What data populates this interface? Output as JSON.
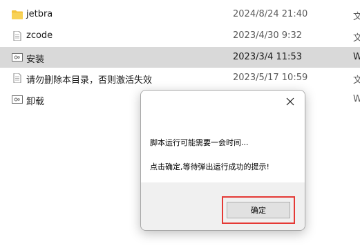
{
  "file_list": {
    "rows": [
      {
        "name": "jetbra",
        "date": "2024/8/24 21:40",
        "type": "文",
        "icon": "folder-icon",
        "selected": false
      },
      {
        "name": "zcode",
        "date": "2023/4/30 9:32",
        "type": "文",
        "icon": "text-file-icon",
        "selected": false
      },
      {
        "name": "安装",
        "date": "2023/3/4 11:53",
        "type": "W",
        "icon": "script-file-icon",
        "selected": true
      },
      {
        "name": "请勿删除本目录，否则激活失效",
        "date": "2023/5/17 10:59",
        "type": "文",
        "icon": "text-file-icon",
        "selected": false
      },
      {
        "name": "卸载",
        "date": "",
        "type": "W",
        "icon": "script-file-icon",
        "selected": false
      }
    ]
  },
  "dialog": {
    "close_icon": "close-icon",
    "message_1": "脚本运行可能需要一会时间...",
    "message_2": "点击确定,等待弹出运行成功的提示!",
    "ok_label": "确定",
    "highlight_color": "#e53935"
  },
  "colors": {
    "folder": "#f4c33d",
    "selected_row": "#d9d9d9"
  }
}
